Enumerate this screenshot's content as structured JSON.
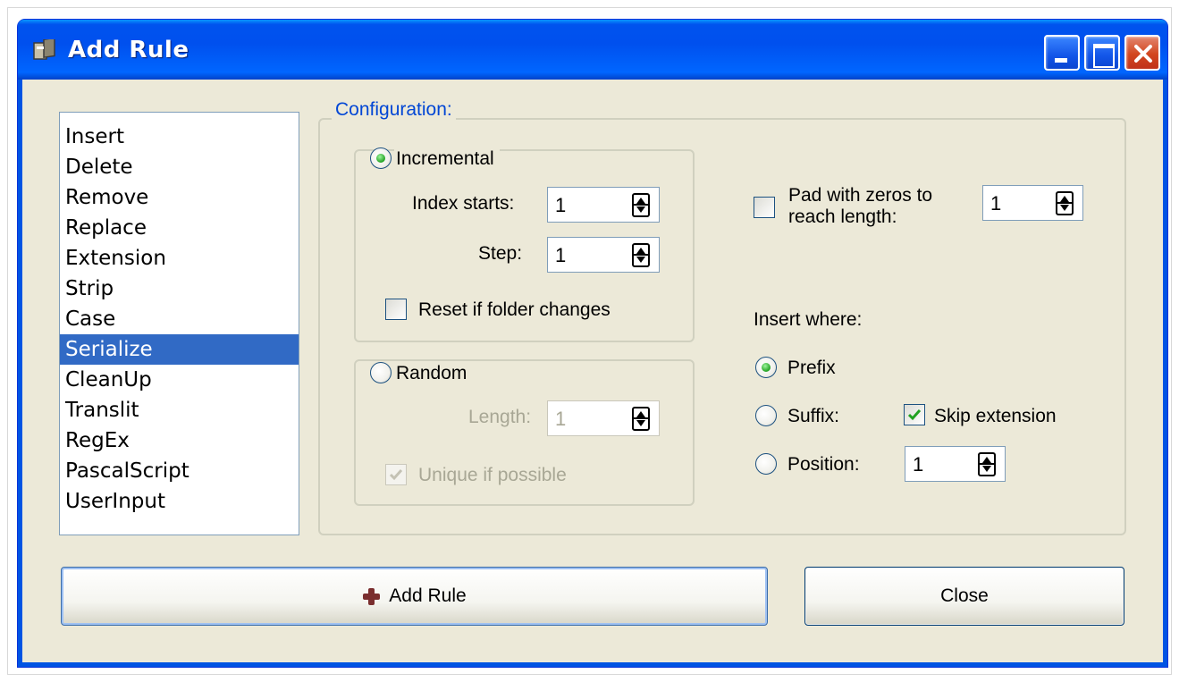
{
  "window": {
    "title": "Add Rule",
    "controls": [
      "minimize-icon",
      "maximize-icon",
      "close-icon"
    ]
  },
  "rules_list": {
    "items": [
      "Insert",
      "Delete",
      "Remove",
      "Replace",
      "Extension",
      "Strip",
      "Case",
      "Serialize",
      "CleanUp",
      "Translit",
      "RegEx",
      "PascalScript",
      "UserInput"
    ],
    "selected": "Serialize"
  },
  "config": {
    "legend": "Configuration:",
    "incremental": {
      "label": "Incremental",
      "checked": true,
      "index_starts_label": "Index starts:",
      "index_starts_value": "1",
      "step_label": "Step:",
      "step_value": "1",
      "reset_label": "Reset if folder changes",
      "reset_checked": false
    },
    "random": {
      "label": "Random",
      "checked": false,
      "length_label": "Length:",
      "length_value": "1",
      "unique_label": "Unique if possible",
      "unique_checked": true
    },
    "pad": {
      "label_line1": "Pad with zeros to",
      "label_line2": "reach length:",
      "checked": false,
      "value": "1"
    },
    "insert_where": {
      "label": "Insert where:",
      "prefix_label": "Prefix",
      "prefix_checked": true,
      "suffix_label": "Suffix:",
      "suffix_checked": false,
      "skip_extension_label": "Skip extension",
      "skip_extension_checked": true,
      "position_label": "Position:",
      "position_checked": false,
      "position_value": "1"
    }
  },
  "buttons": {
    "add_rule": "Add Rule",
    "close": "Close"
  },
  "colors": {
    "titlebar": "#0054e3",
    "face": "#ece9d8",
    "selection": "#316ac5",
    "legend": "#0046d5"
  }
}
